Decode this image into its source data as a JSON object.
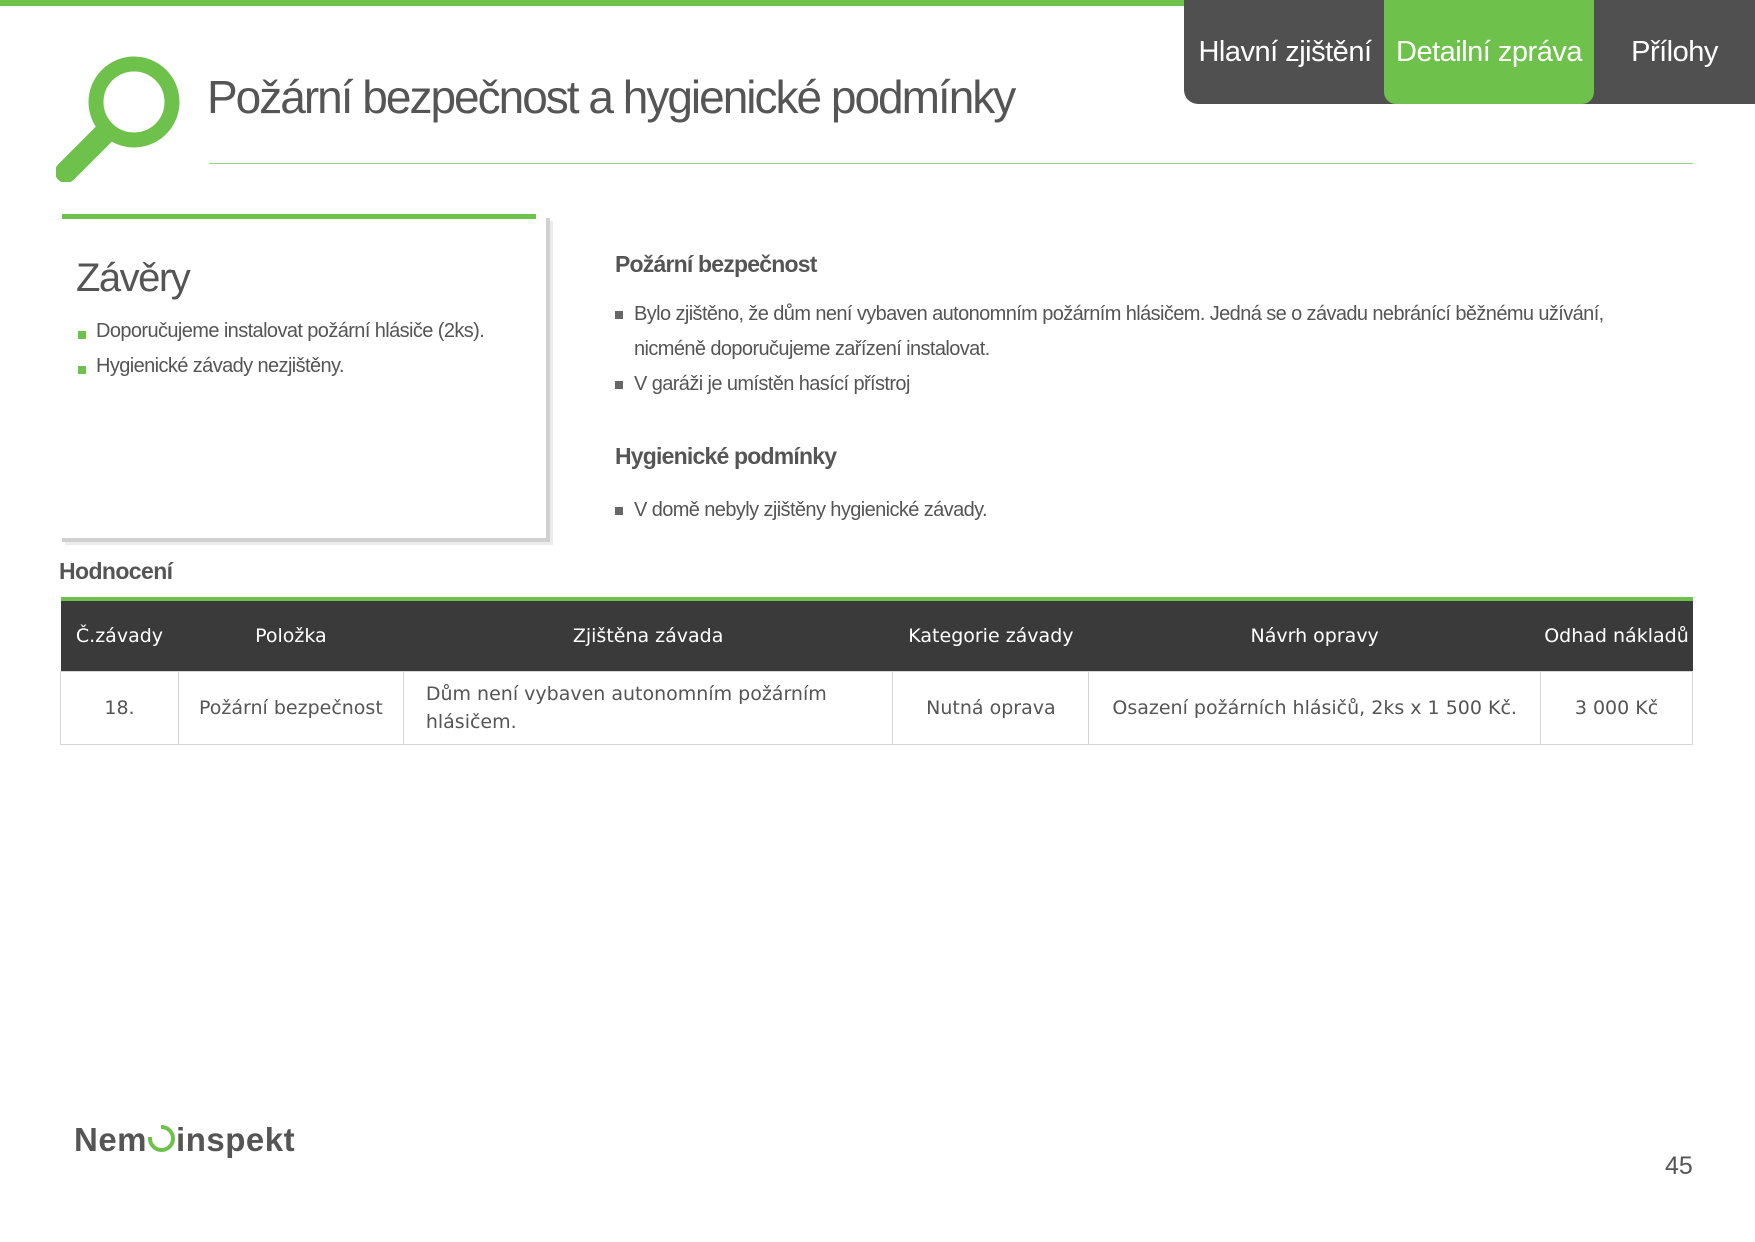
{
  "nav": {
    "tabs": [
      {
        "label": "Hlavní zjištění",
        "active": false
      },
      {
        "label": "Detailní zpráva",
        "active": true
      },
      {
        "label": "Přílohy",
        "active": false
      }
    ]
  },
  "page": {
    "title": "Požární bezpečnost a hygienické podmínky",
    "icon": "magnifier-icon",
    "page_number": "45"
  },
  "conclusions": {
    "heading": "Závěry",
    "items": [
      "Doporučujeme instalovat požární hlásiče (2ks).",
      "Hygienické závady nezjištěny."
    ]
  },
  "sections": [
    {
      "heading": "Požární bezpečnost",
      "items": [
        "Bylo zjištěno, že dům není vybaven autonomním požárním hlásičem. Jedná se o závadu nebránící běžnému užívání, nicméně doporučujeme zařízení instalovat.",
        "V garáži je umístěn hasící přístroj"
      ]
    },
    {
      "heading": "Hygienické podmínky",
      "items": [
        "V domě nebyly zjištěny hygienické závady."
      ]
    }
  ],
  "evaluation": {
    "label": "Hodnocení",
    "columns": [
      "Č.závady",
      "Položka",
      "Zjištěna závada",
      "Kategorie závady",
      "Návrh opravy",
      "Odhad nákladů"
    ],
    "rows": [
      [
        "18.",
        "Požární bezpečnost",
        "Dům není vybaven autonomním požárním hlásičem.",
        "Nutná oprava",
        "Osazení požárních hlásičů, 2ks x 1 500 Kč.",
        "3 000 Kč"
      ]
    ]
  },
  "footer": {
    "brand_before": "Nem",
    "brand_after": "inspekt"
  },
  "colors": {
    "accent": "#6ec14a",
    "nav_bg": "#505050",
    "table_header": "#3a3a3a",
    "text": "#555555"
  }
}
